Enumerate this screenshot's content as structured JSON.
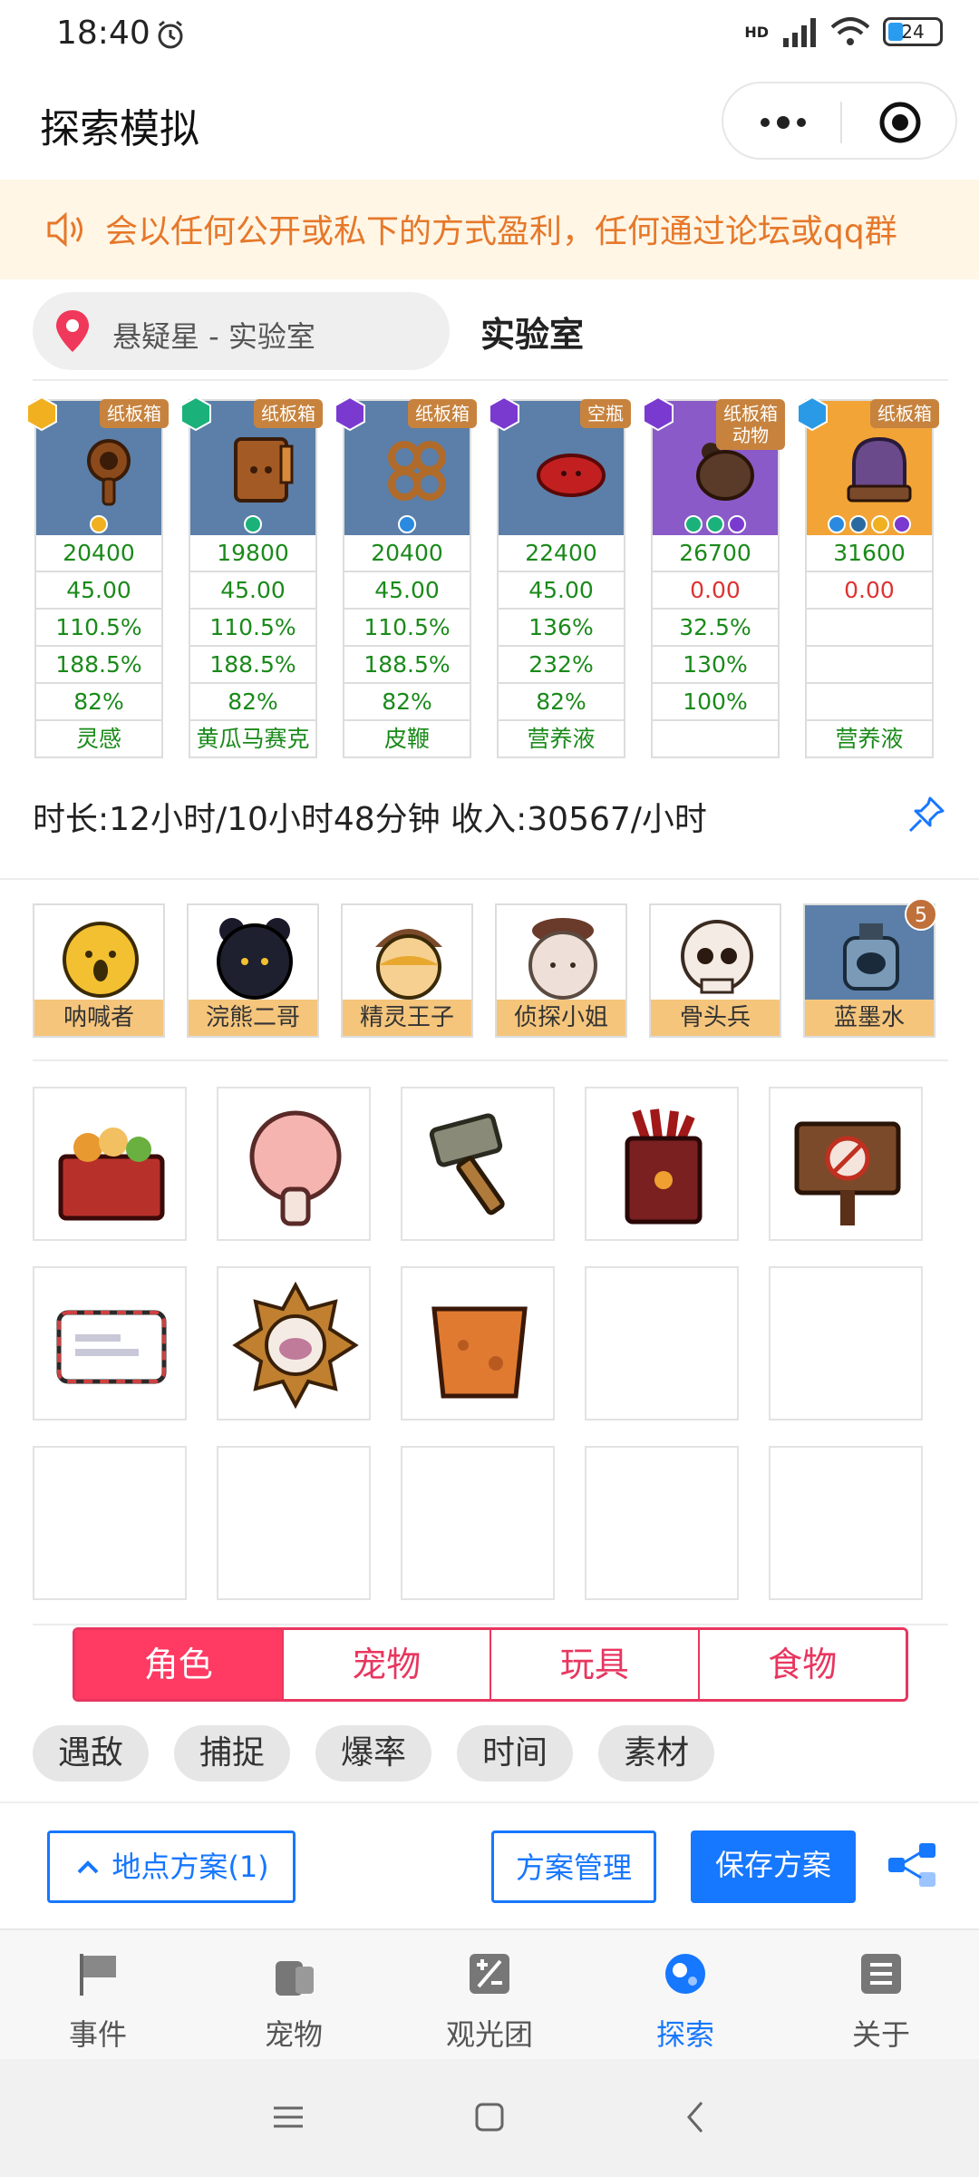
{
  "status_bar": {
    "time": "18:40",
    "battery": "24",
    "network": "HD"
  },
  "header": {
    "title": "探索模拟"
  },
  "notice": {
    "text": "会以任何公开或私下的方式盈利，任何通过论坛或qq群"
  },
  "location": {
    "label": "悬疑星 - 实验室",
    "title": "实验室"
  },
  "cards": [
    {
      "tag": "纸板箱",
      "values": [
        "20400",
        "45.00",
        "110.5%",
        "188.5%",
        "82%",
        "灵感"
      ]
    },
    {
      "tag": "纸板箱",
      "values": [
        "19800",
        "45.00",
        "110.5%",
        "188.5%",
        "82%",
        "黄瓜马赛克"
      ]
    },
    {
      "tag": "纸板箱",
      "values": [
        "20400",
        "45.00",
        "110.5%",
        "188.5%",
        "82%",
        "皮鞭"
      ]
    },
    {
      "tag": "空瓶",
      "values": [
        "22400",
        "45.00",
        "136%",
        "232%",
        "82%",
        "营养液"
      ]
    },
    {
      "tag": "纸板箱\n动物",
      "values": [
        "26700",
        "0.00",
        "32.5%",
        "130%",
        "100%",
        ""
      ]
    },
    {
      "tag": "纸板箱",
      "values": [
        "31600",
        "0.00",
        "",
        "",
        "",
        "营养液"
      ]
    }
  ],
  "summary": {
    "text": "时长:12小时/10小时48分钟 收入:30567/小时"
  },
  "characters": [
    {
      "name": "呐喊者"
    },
    {
      "name": "浣熊二哥"
    },
    {
      "name": "精灵王子"
    },
    {
      "name": "侦探小姐"
    },
    {
      "name": "骨头兵"
    },
    {
      "name": "蓝墨水",
      "count": "5"
    }
  ],
  "items": [
    {
      "icon": "food-basket-icon"
    },
    {
      "icon": "mushroom-icon"
    },
    {
      "icon": "hammer-sword-icon"
    },
    {
      "icon": "paw-box-icon"
    },
    {
      "icon": "no-sign-board-icon"
    },
    {
      "icon": "envelope-icon"
    },
    {
      "icon": "sun-badge-icon"
    },
    {
      "icon": "clay-pot-icon"
    }
  ],
  "category_tabs": [
    {
      "label": "角色",
      "active": true
    },
    {
      "label": "宠物",
      "active": false
    },
    {
      "label": "玩具",
      "active": false
    },
    {
      "label": "食物",
      "active": false
    }
  ],
  "filter_chips": [
    "遇敌",
    "捕捉",
    "爆率",
    "时间",
    "素材"
  ],
  "actions": {
    "location_plan": "地点方案(1)",
    "plan_manage": "方案管理",
    "save_plan": "保存方案"
  },
  "tabbar": [
    {
      "label": "事件",
      "icon": "flag-icon",
      "active": false
    },
    {
      "label": "宠物",
      "icon": "pet-icon",
      "active": false
    },
    {
      "label": "观光团",
      "icon": "calculator-icon",
      "active": false
    },
    {
      "label": "探索",
      "icon": "explore-icon",
      "active": true
    },
    {
      "label": "关于",
      "icon": "list-icon",
      "active": false
    }
  ],
  "colors": {
    "accent_blue": "#1677ff",
    "accent_pink": "#ff3a63",
    "notice_text": "#e6782a",
    "value_green": "#1a8a1a",
    "value_red": "#dd3333"
  }
}
